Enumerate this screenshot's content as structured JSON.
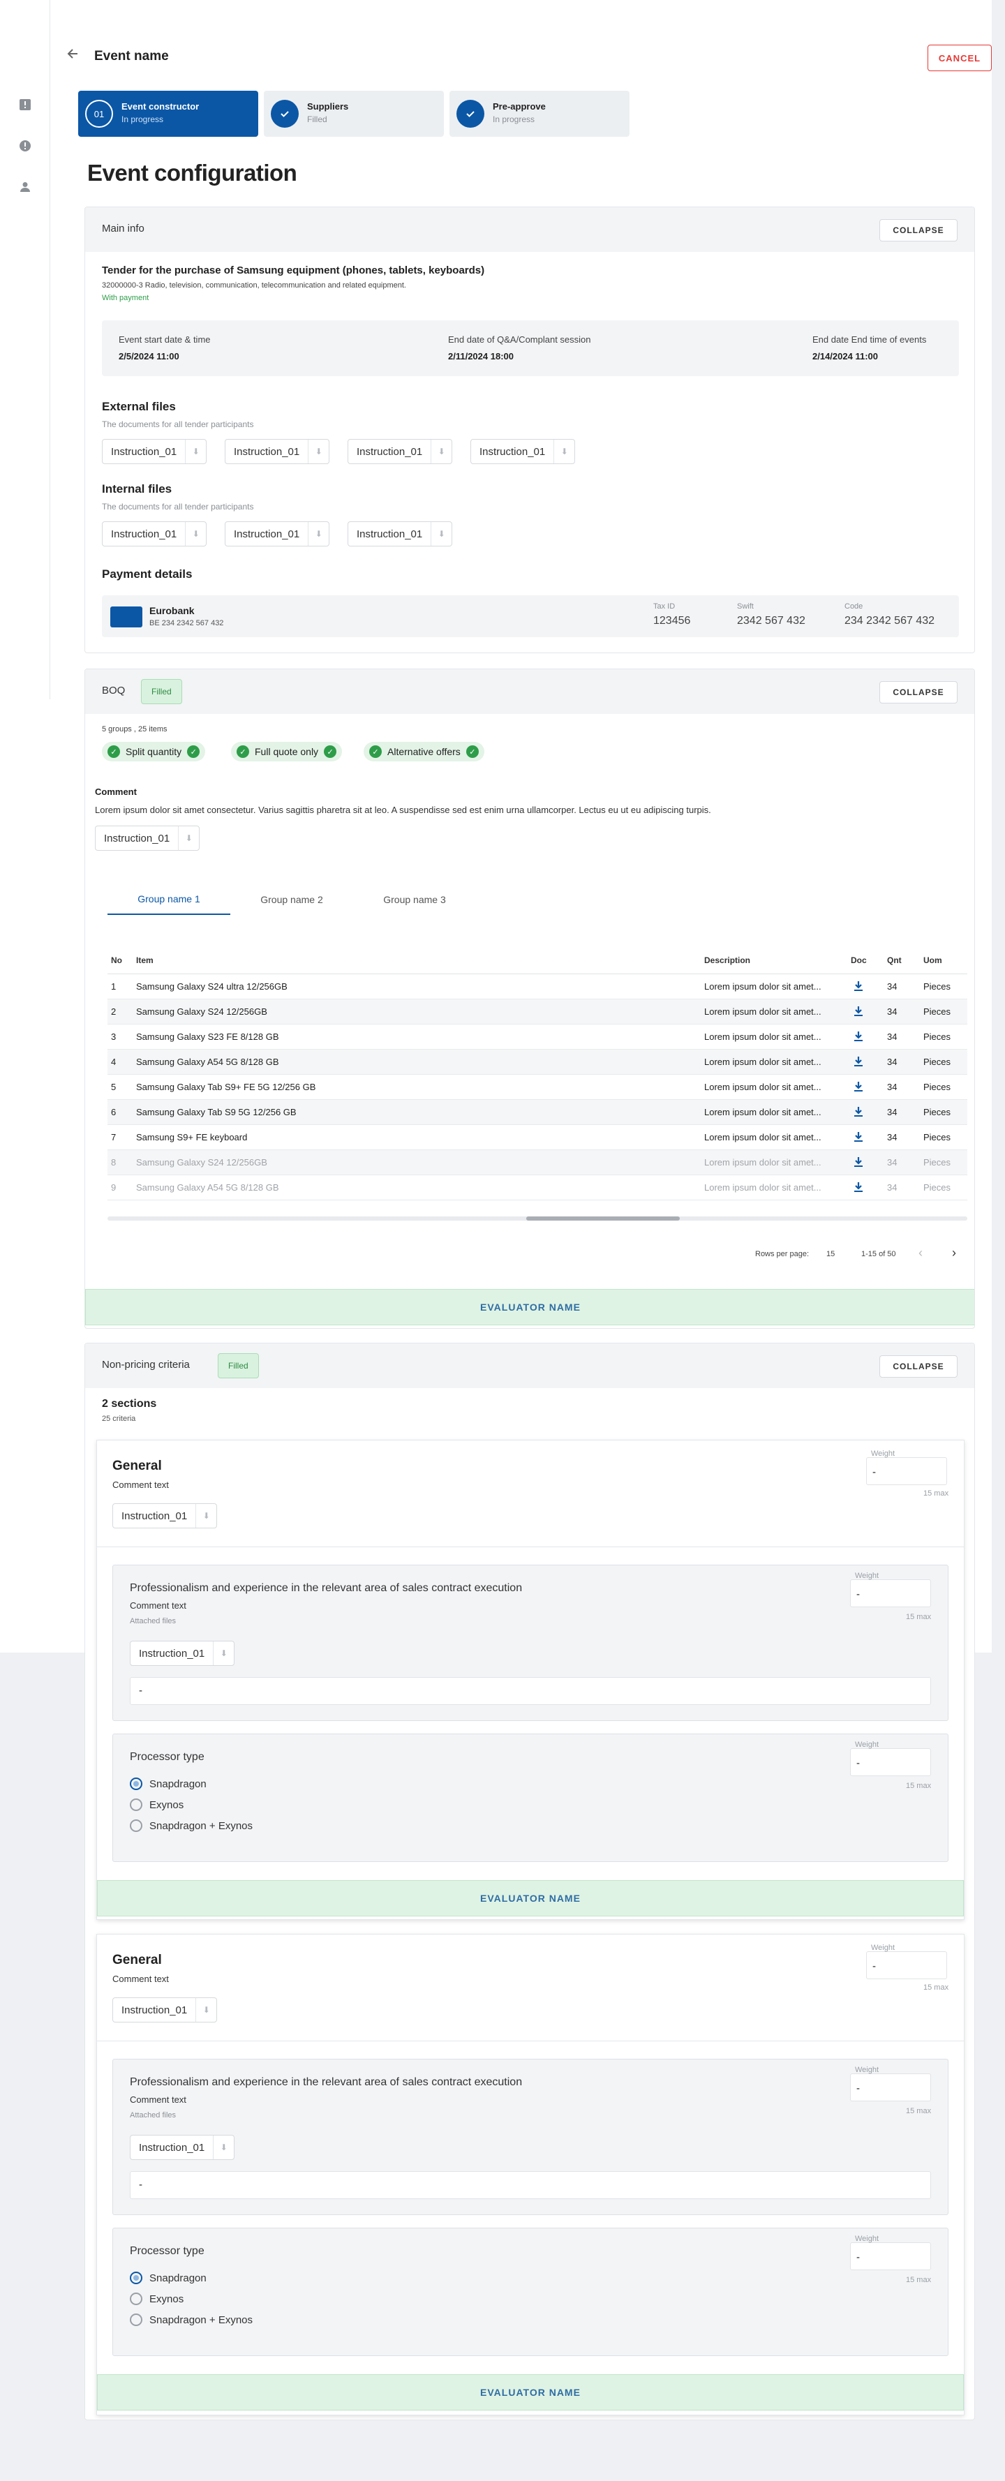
{
  "header": {
    "title": "Event name",
    "cancel_label": "CANCEL"
  },
  "steps": [
    {
      "num": "01",
      "name": "Event constructor",
      "status": "In progress"
    },
    {
      "name": "Suppliers",
      "status": "Filled"
    },
    {
      "name": "Pre-approve",
      "status": "In progress"
    }
  ],
  "page_title": "Event configuration",
  "collapse_label": "COLLAPSE",
  "main_info": {
    "title": "Main info",
    "tender_title": "Tender for the purchase of Samsung equipment (phones, tablets, keyboards)",
    "cpv": "32000000-3 Radio, television, communication, telecommunication and related equipment.",
    "payment_tag": "With payment",
    "dates": [
      {
        "label": "Event start date & time",
        "value": "2/5/2024 11:00"
      },
      {
        "label": "End date of Q&A/Complant session",
        "value": "2/11/2024 18:00"
      },
      {
        "label": "End date End time of events",
        "value": "2/14/2024 11:00"
      }
    ],
    "external_files": {
      "title": "External files",
      "subtitle": "The documents for all tender participants",
      "files": [
        "Instruction_01",
        "Instruction_01",
        "Instruction_01",
        "Instruction_01"
      ]
    },
    "internal_files": {
      "title": "Internal files",
      "subtitle": "The documents for all tender participants",
      "files": [
        "Instruction_01",
        "Instruction_01",
        "Instruction_01"
      ]
    },
    "payment": {
      "title": "Payment details",
      "bank": "Eurobank",
      "iban": "BE 234 2342 567 432",
      "fields": [
        {
          "label": "Tax ID",
          "value": "123456"
        },
        {
          "label": "Swift",
          "value": "2342 567 432"
        },
        {
          "label": "Code",
          "value": "234 2342 567 432"
        }
      ]
    }
  },
  "boq": {
    "title": "BOQ",
    "badge": "Filled",
    "summary": "5 groups , 25 items",
    "features": [
      "Split quantity",
      "Full quote only",
      "Alternative offers"
    ],
    "comment_title": "Comment",
    "comment": "Lorem ipsum dolor sit amet consectetur. Varius sagittis pharetra sit at leo. A suspendisse sed est enim urna ullamcorper. Lectus eu ut eu adipiscing turpis.",
    "file": "Instruction_01",
    "tabs": [
      "Group name 1",
      "Group name 2",
      "Group name 3"
    ],
    "columns": [
      "No",
      "Item",
      "Description",
      "Doc",
      "Qnt",
      "Uom"
    ],
    "rows": [
      {
        "no": "1",
        "item": "Samsung Galaxy S24 ultra 12/256GB",
        "desc": "Lorem ipsum dolor sit amet...",
        "qnt": "34",
        "uom": "Pieces"
      },
      {
        "no": "2",
        "item": "Samsung Galaxy S24 12/256GB",
        "desc": "Lorem ipsum dolor sit amet...",
        "qnt": "34",
        "uom": "Pieces"
      },
      {
        "no": "3",
        "item": "Samsung Galaxy S23 FE 8/128 GB",
        "desc": "Lorem ipsum dolor sit amet...",
        "qnt": "34",
        "uom": "Pieces"
      },
      {
        "no": "4",
        "item": "Samsung Galaxy A54 5G 8/128 GB",
        "desc": "Lorem ipsum dolor sit amet...",
        "qnt": "34",
        "uom": "Pieces"
      },
      {
        "no": "5",
        "item": "Samsung Galaxy  Tab S9+ FE 5G 12/256 GB",
        "desc": "Lorem ipsum dolor sit amet...",
        "qnt": "34",
        "uom": "Pieces"
      },
      {
        "no": "6",
        "item": "Samsung Galaxy Tab S9 5G 12/256 GB",
        "desc": "Lorem ipsum dolor sit amet...",
        "qnt": "34",
        "uom": "Pieces"
      },
      {
        "no": "7",
        "item": "Samsung S9+ FE keyboard",
        "desc": "Lorem ipsum dolor sit amet...",
        "qnt": "34",
        "uom": "Pieces"
      },
      {
        "no": "8",
        "item": "Samsung Galaxy S24 12/256GB",
        "desc": "Lorem ipsum dolor sit amet...",
        "qnt": "34",
        "uom": "Pieces"
      },
      {
        "no": "9",
        "item": "Samsung Galaxy A54 5G 8/128 GB",
        "desc": "Lorem ipsum dolor sit amet...",
        "qnt": "34",
        "uom": "Pieces"
      }
    ],
    "pagination": {
      "rows_label": "Rows per page:",
      "rows_value": "15",
      "range": "1-15 of 50"
    },
    "evaluator": "EVALUATOR NAME"
  },
  "npc": {
    "title": "Non-pricing criteria",
    "badge": "Filled",
    "sections_count": "2 sections",
    "criteria_count": "25 criteria",
    "sections": [
      {
        "title": "General",
        "comment": "Comment text",
        "file": "Instruction_01",
        "weight_label": "Weight",
        "weight": "-",
        "max": "15 max",
        "crit1": {
          "title": "Professionalism and experience in the relevant area of sales contract execution",
          "comment": "Comment text",
          "attached": "Attached files",
          "file": "Instruction_01",
          "value": "-",
          "weight_label": "Weight",
          "weight": "-",
          "max": "15 max"
        },
        "crit2": {
          "title": "Processor type",
          "weight_label": "Weight",
          "weight": "-",
          "max": "15 max",
          "options": [
            "Snapdragon",
            "Exynos",
            "Snapdragon + Exynos"
          ]
        },
        "evaluator": "EVALUATOR NAME"
      },
      {
        "title": "General",
        "comment": "Comment text",
        "file": "Instruction_01",
        "weight_label": "Weight",
        "weight": "-",
        "max": "15 max",
        "crit1": {
          "title": "Professionalism and experience in the relevant area of sales contract execution",
          "comment": "Comment text",
          "attached": "Attached files",
          "file": "Instruction_01",
          "value": "-",
          "weight_label": "Weight",
          "weight": "-",
          "max": "15 max"
        },
        "crit2": {
          "title": "Processor type",
          "weight_label": "Weight",
          "weight": "-",
          "max": "15 max",
          "options": [
            "Snapdragon",
            "Exynos",
            "Snapdragon + Exynos"
          ]
        },
        "evaluator": "EVALUATOR NAME"
      }
    ]
  },
  "colors": {
    "primary": "#0b57a6",
    "success": "#2e9d49",
    "danger": "#e53935"
  }
}
